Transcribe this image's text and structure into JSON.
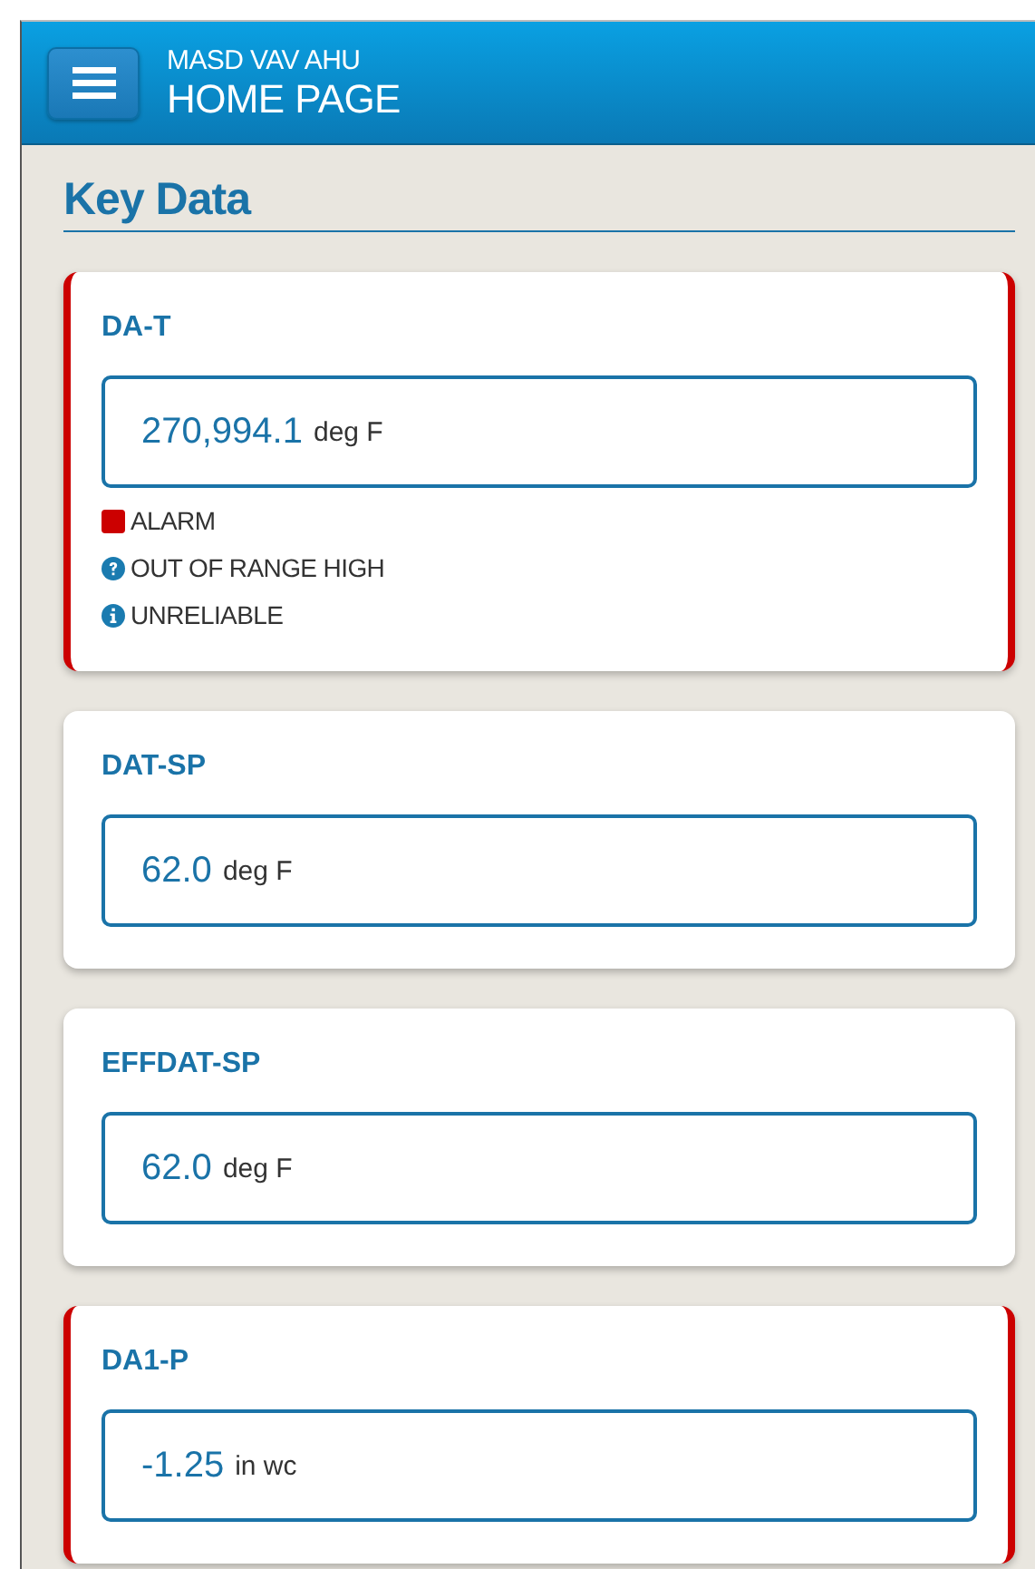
{
  "header": {
    "subtitle": "MASD VAV AHU",
    "title": "HOME PAGE"
  },
  "section": {
    "title": "Key Data"
  },
  "points": [
    {
      "name": "DA-T",
      "value": "270,994.1",
      "units": "deg F",
      "alarm": true,
      "statuses": [
        {
          "kind": "alarm",
          "text": "ALARM"
        },
        {
          "kind": "question",
          "text": "OUT OF RANGE HIGH"
        },
        {
          "kind": "info",
          "text": "UNRELIABLE"
        }
      ]
    },
    {
      "name": "DAT-SP",
      "value": "62.0",
      "units": "deg F",
      "alarm": false
    },
    {
      "name": "EFFDAT-SP",
      "value": "62.0",
      "units": "deg F",
      "alarm": false
    },
    {
      "name": "DA1-P",
      "value": "-1.25",
      "units": "in wc",
      "alarm": true
    }
  ]
}
